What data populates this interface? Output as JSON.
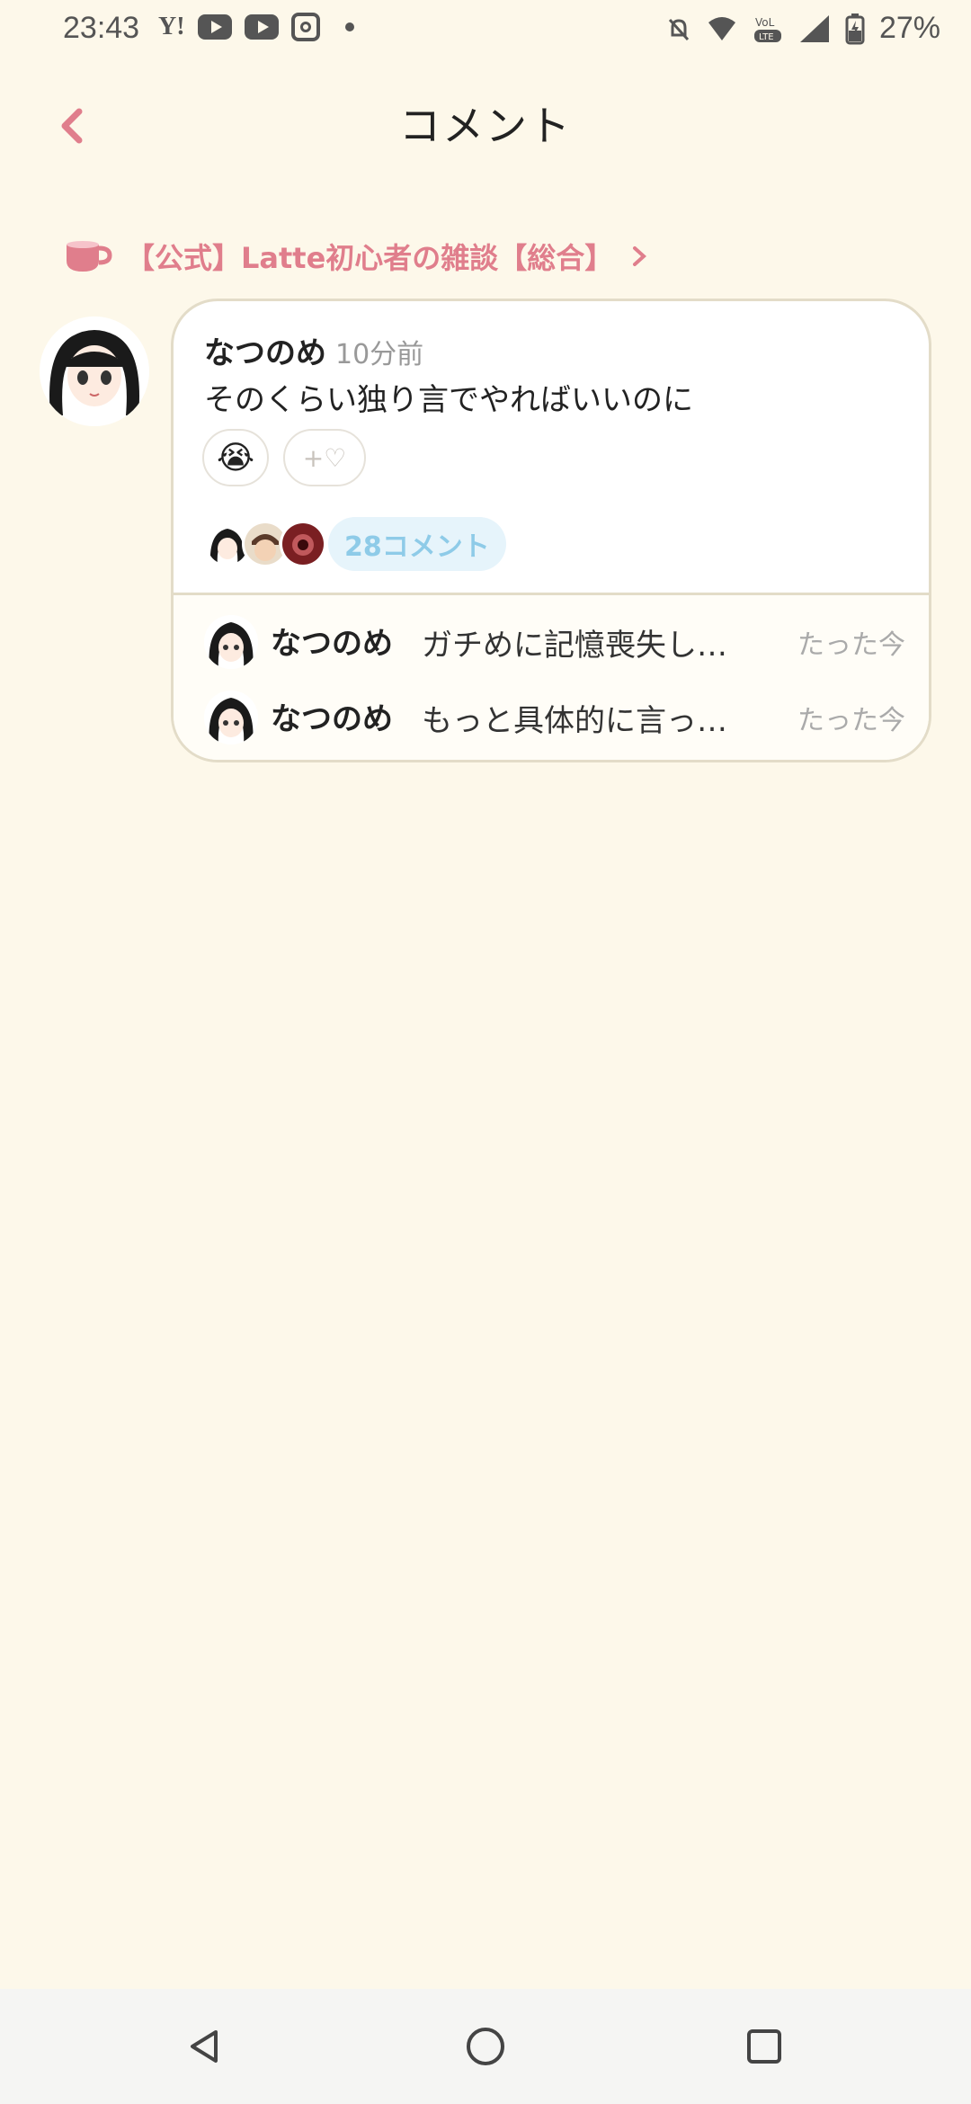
{
  "status_bar": {
    "time": "23:43",
    "yahoo": "Y!",
    "battery": "27%",
    "icons": [
      "yahoo-icon",
      "youtube-icon",
      "youtube-icon",
      "instagram-icon",
      "dot-icon",
      "bell-off-icon",
      "wifi-icon",
      "volte-icon",
      "signal-icon",
      "battery-icon"
    ]
  },
  "header": {
    "title": "コメント",
    "back_icon": "chevron-left-icon"
  },
  "category": {
    "label": "【公式】Latte初心者の雑談【総合】",
    "icon": "cup-icon",
    "accent": "#e07e8c"
  },
  "post": {
    "author": "なつのめ",
    "time": "10分前",
    "text": "そのくらい独り言でやればいいのに",
    "reaction_emoji": "😭",
    "add_reaction_label": "+♡",
    "comment_count": "28コメント"
  },
  "replies": [
    {
      "author": "なつのめ",
      "text": "ガチめに記憶喪失し…",
      "time": "たった今"
    },
    {
      "author": "なつのめ",
      "text": "もっと具体的に言っ…",
      "time": "たった今"
    }
  ],
  "navbar": {
    "icons": [
      "back-triangle-icon",
      "home-circle-icon",
      "recents-square-icon"
    ]
  }
}
